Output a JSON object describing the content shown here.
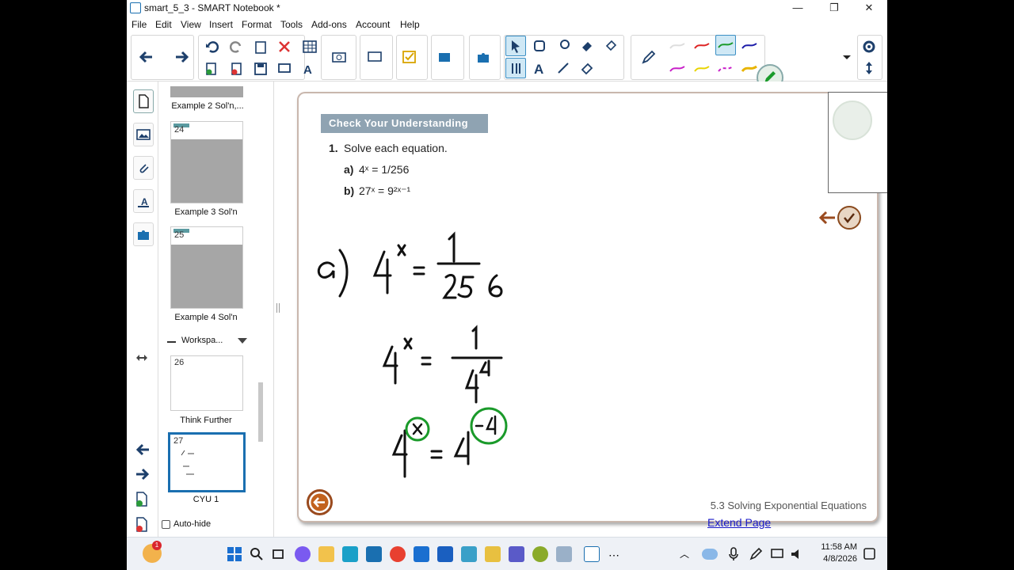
{
  "window": {
    "title": "smart_5_3 - SMART Notebook *",
    "minimize": "—",
    "maximize": "❐",
    "close": "✕"
  },
  "menu": [
    "File",
    "Edit",
    "View",
    "Insert",
    "Format",
    "Tools",
    "Add-ons",
    "Account",
    "Help"
  ],
  "sorter": {
    "items": [
      {
        "label": "Example 2 Sol'n,..."
      },
      {
        "num": "24",
        "label": "Example 3 Sol'n"
      },
      {
        "num": "25",
        "label": "Example 4 Sol'n"
      },
      {
        "num": "26",
        "label": "Think Further"
      },
      {
        "num": "27",
        "label": "CYU 1"
      }
    ],
    "group_label": "Workspa...",
    "autohide_label": "Auto-hide"
  },
  "page": {
    "header": "Check Your Understanding",
    "q_number": "1.",
    "q_text": "Solve each equation.",
    "part_a": "a)",
    "part_a_expr": "4ˣ = 1/256",
    "part_b": "b)",
    "part_b_expr": "27ˣ = 9²ˣ⁻¹",
    "footer": "5.3 Solving Exponential Equations",
    "extend": "Extend Page"
  },
  "handwriting": {
    "line1": "a)  4^x = 1/256",
    "line2": "4^x = 1/4^4",
    "line3": "4^x = 4^-4"
  },
  "taskbar": {
    "time": "11:58 AM",
    "date": "4/8/2026",
    "badge": "1"
  },
  "colors": {
    "accent": "#1a6fb0",
    "header_bg": "#8fa3b2",
    "ink_black": "#111111",
    "ink_green": "#1a9a2a"
  }
}
